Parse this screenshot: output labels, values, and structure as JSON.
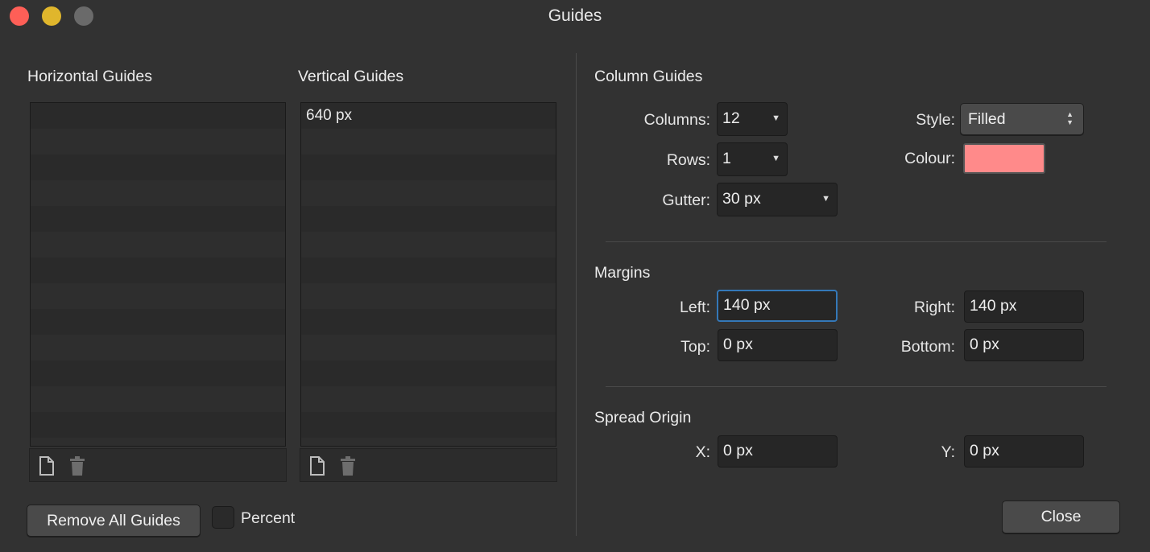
{
  "window": {
    "title": "Guides"
  },
  "horizontal": {
    "label": "Horizontal Guides",
    "items": []
  },
  "vertical": {
    "label": "Vertical Guides",
    "items": [
      "640 px"
    ]
  },
  "bottom": {
    "remove_all": "Remove All Guides",
    "percent": "Percent",
    "percent_checked": false
  },
  "columns": {
    "label": "Column Guides",
    "columns_label": "Columns:",
    "columns_value": "12",
    "rows_label": "Rows:",
    "rows_value": "1",
    "gutter_label": "Gutter:",
    "gutter_value": "30 px",
    "style_label": "Style:",
    "style_value": "Filled",
    "colour_label": "Colour:",
    "colour_value": "#ff8a8a"
  },
  "margins": {
    "label": "Margins",
    "left_label": "Left:",
    "left_value": "140 px",
    "right_label": "Right:",
    "right_value": "140 px",
    "top_label": "Top:",
    "top_value": "0 px",
    "bottom_label": "Bottom:",
    "bottom_value": "0 px"
  },
  "spread": {
    "label": "Spread Origin",
    "x_label": "X:",
    "x_value": "0 px",
    "y_label": "Y:",
    "y_value": "0 px"
  },
  "close_label": "Close",
  "colors": {
    "close_light": "#fe5f57",
    "minimize_light": "#e0b62c",
    "zoom_light": "#6a6a6a"
  }
}
